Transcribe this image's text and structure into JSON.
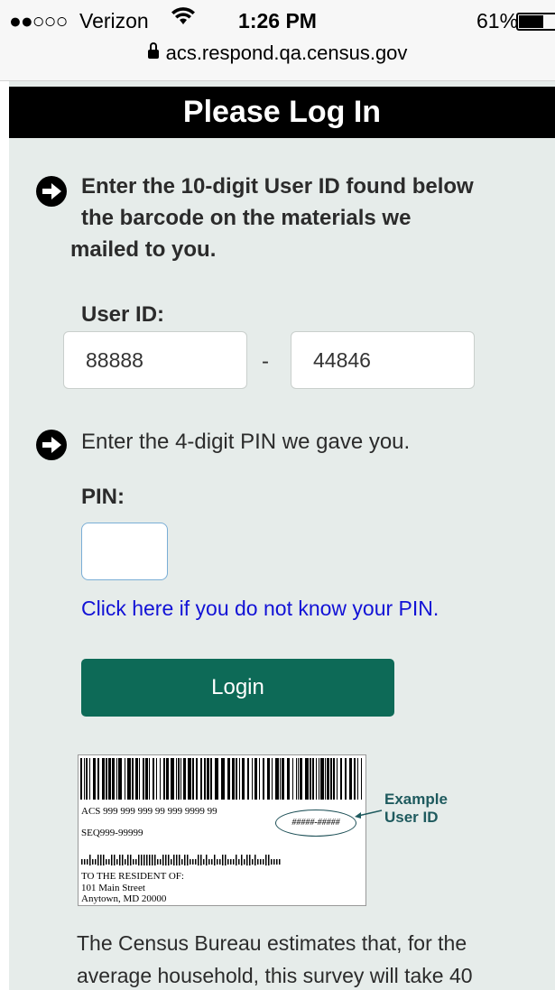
{
  "status_bar": {
    "signal": "●●○○○",
    "carrier": "Verizon",
    "time": "1:26 PM",
    "battery_text": "61%",
    "battery_level": 0.61,
    "url": "acs.respond.qa.census.gov"
  },
  "page": {
    "title": "Please Log In",
    "step1": {
      "line1": "Enter the 10-digit User ID found below",
      "line2": "the barcode on the materials we",
      "line3": "mailed to you."
    },
    "user_id": {
      "label": "User ID:",
      "part1_value": "88888",
      "separator": "-",
      "part2_value": "44846"
    },
    "step2": "Enter the 4-digit PIN we gave you.",
    "pin": {
      "label": "PIN:",
      "value": "",
      "help_link": "Click here if you do not know your PIN."
    },
    "login_label": "Login",
    "example_label": {
      "line1": "ACS 999 999 999 99 999 9999 99",
      "line2": "SEQ999-99999",
      "user_id_mask": "#####-#####",
      "addr1": "TO THE RESIDENT OF:",
      "addr2": "101 Main Street",
      "addr3": "Anytown, MD 20000",
      "caption_line1": "Example",
      "caption_line2": "User ID"
    },
    "estimate_text": "The Census Bureau estimates that, for the average household, this survey will take 40"
  },
  "colors": {
    "page_bg": "#e6ecea",
    "title_bg": "#000000",
    "login_bg": "#0d6a57",
    "link": "#1212d6"
  }
}
